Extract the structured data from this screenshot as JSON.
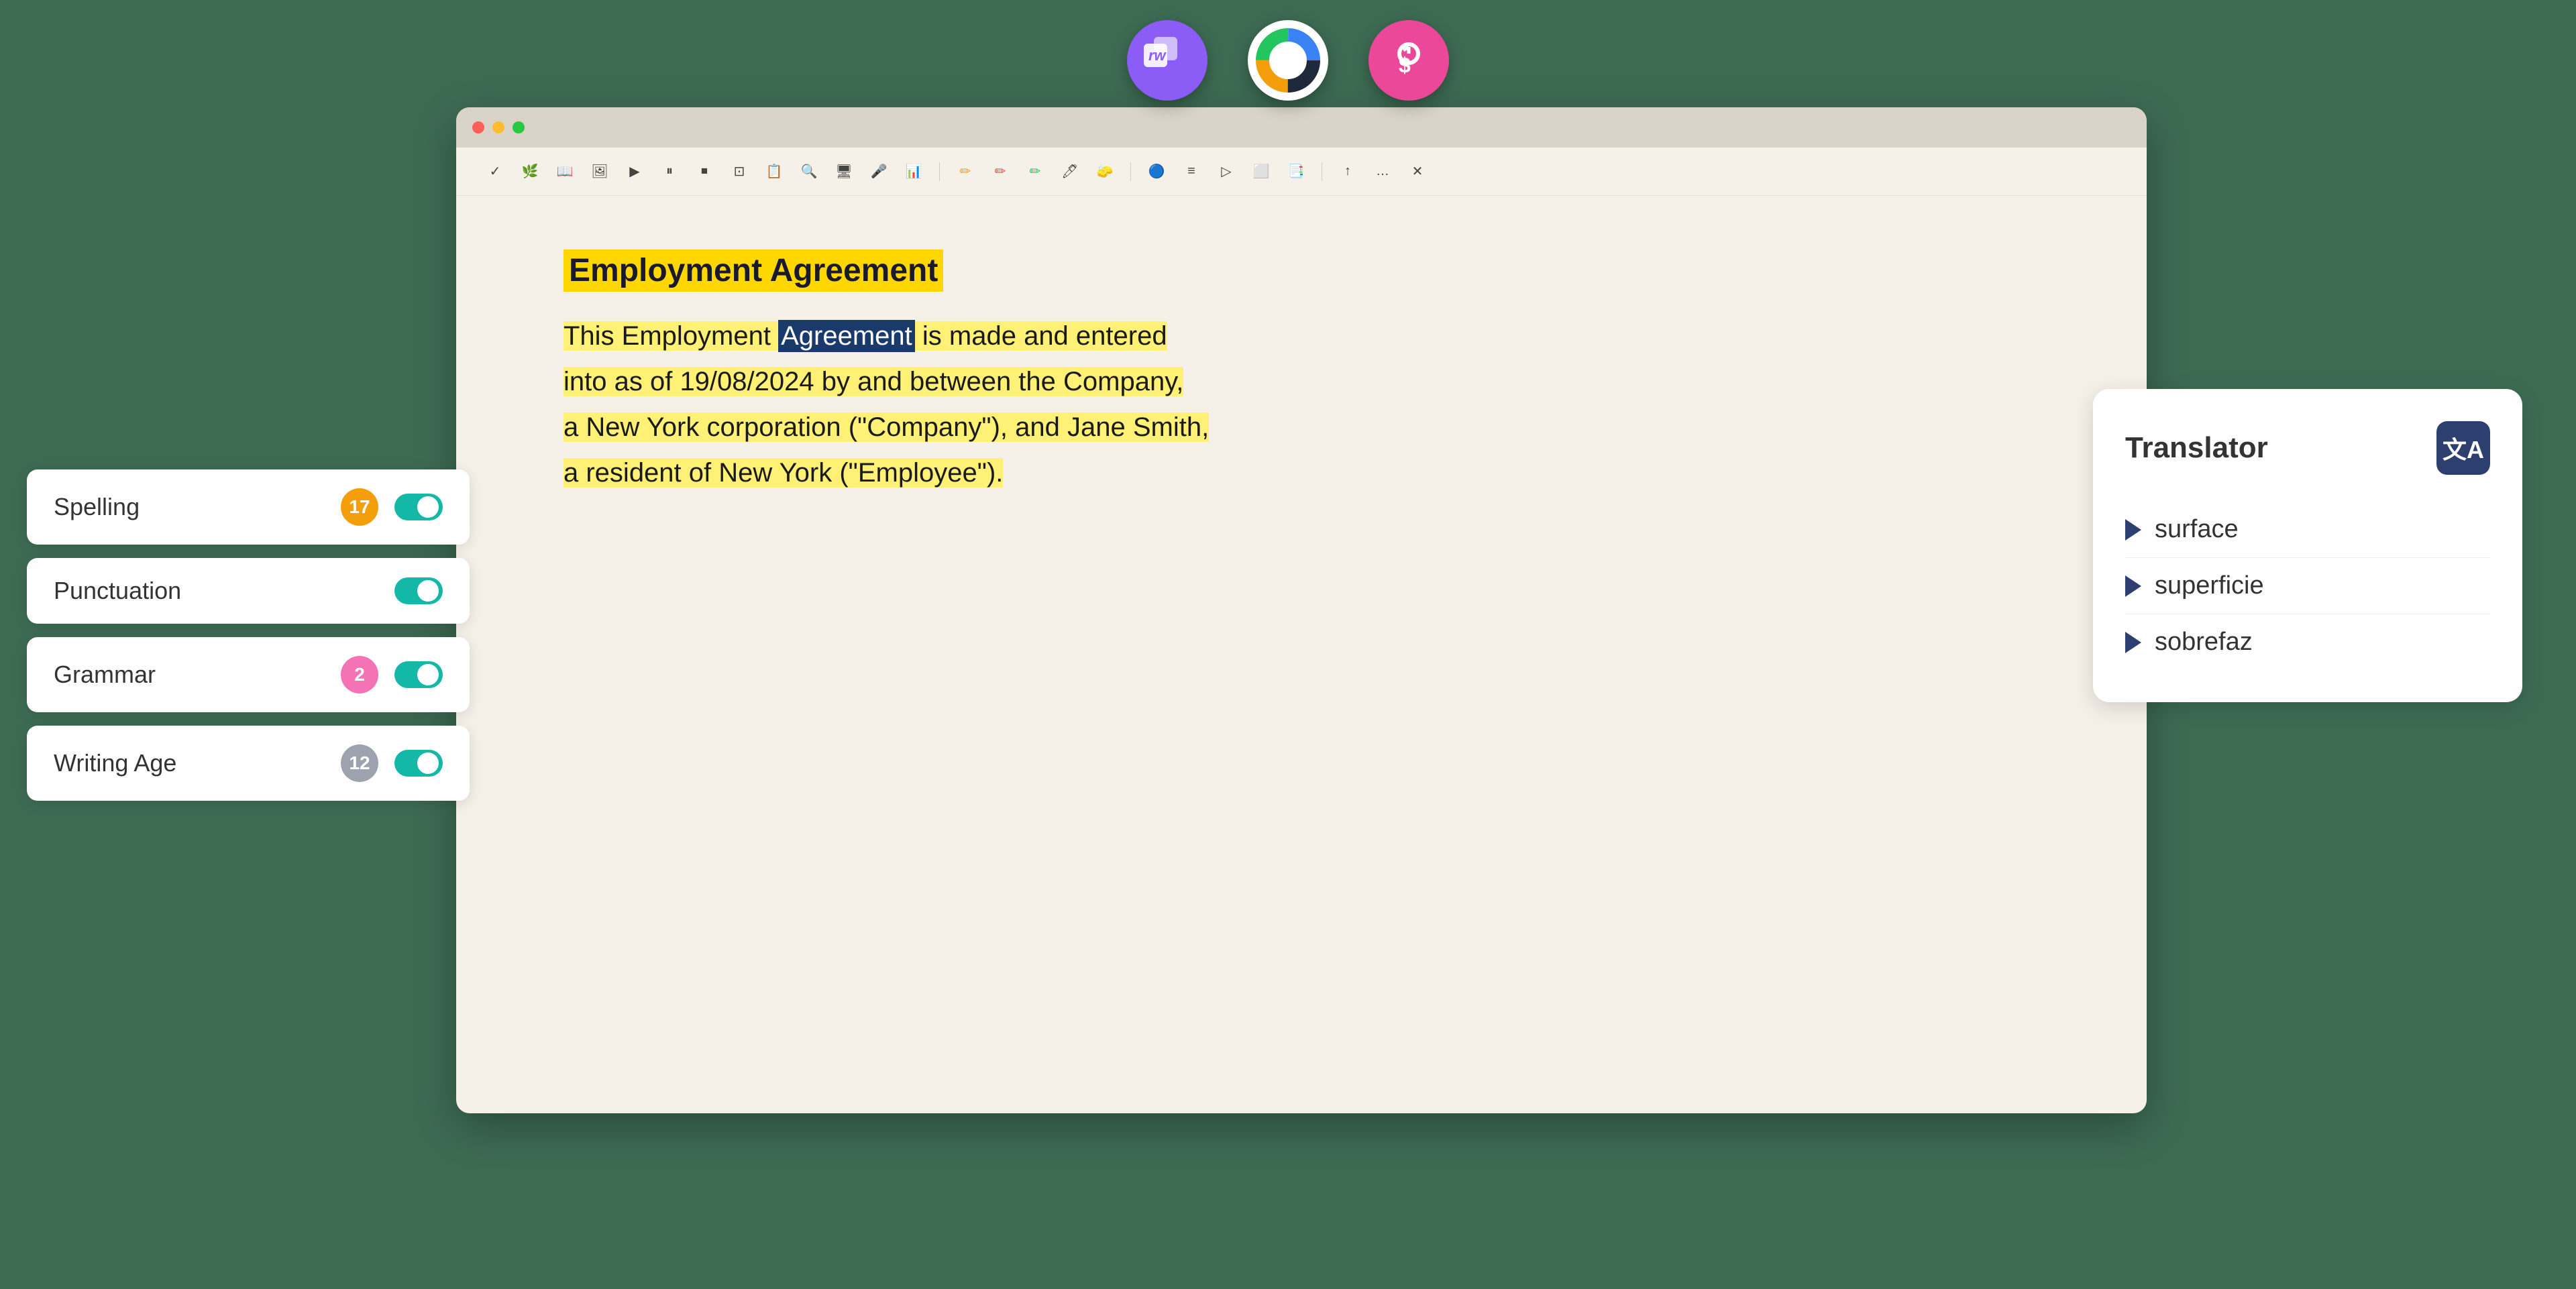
{
  "background_color": "#3d6b52",
  "app_icons": [
    {
      "id": "rw-icon",
      "label": "rw",
      "type": "purple",
      "color": "#8b5cf6"
    },
    {
      "id": "colorful-icon",
      "label": "color-wheel",
      "type": "colorful"
    },
    {
      "id": "s-icon",
      "label": "S",
      "type": "pink",
      "color": "#ec4899"
    }
  ],
  "window": {
    "traffic_lights": [
      "red",
      "yellow",
      "green"
    ],
    "toolbar_icons": [
      "✓",
      "🌿",
      "📚",
      "🖼",
      "▶",
      "⏸",
      "⏹",
      "⊡",
      "📋",
      "🔍",
      "🖥",
      "🎤",
      "📊",
      "✏",
      "✏",
      "✏",
      "✏",
      "📐",
      "🔵",
      "≡",
      "▶",
      "⬜",
      "📑",
      "↑",
      "…",
      "✕"
    ]
  },
  "document": {
    "title": "Employment Agreement",
    "paragraph_parts": [
      {
        "text": "This Employment ",
        "highlight": "yellow"
      },
      {
        "text": "Agreement",
        "highlight": "blue"
      },
      {
        "text": " is made and entered",
        "highlight": "yellow"
      },
      {
        "text": "into as of 19/08/2024 by and between the Company,",
        "highlight": "yellow"
      },
      {
        "text": "a New York corporation (\"Company\"), and Jane Smith,",
        "highlight": "yellow"
      },
      {
        "text": "a resident of New York (\"Employee\").",
        "highlight": "yellow"
      }
    ]
  },
  "checks_panel": {
    "items": [
      {
        "id": "spelling",
        "label": "Spelling",
        "badge_value": "17",
        "badge_color": "#f59e0b",
        "toggle_on": true
      },
      {
        "id": "punctuation",
        "label": "Punctuation",
        "badge_value": null,
        "badge_color": null,
        "toggle_on": true
      },
      {
        "id": "grammar",
        "label": "Grammar",
        "badge_value": "2",
        "badge_color": "#f472b6",
        "toggle_on": true
      },
      {
        "id": "writing-age",
        "label": "Writing Age",
        "badge_value": "12",
        "badge_color": "#9ca3af",
        "toggle_on": true
      }
    ]
  },
  "translator": {
    "title": "Translator",
    "icon_symbol": "文A",
    "items": [
      {
        "word": "surface"
      },
      {
        "word": "superficie"
      },
      {
        "word": "sobrefaz"
      }
    ]
  }
}
